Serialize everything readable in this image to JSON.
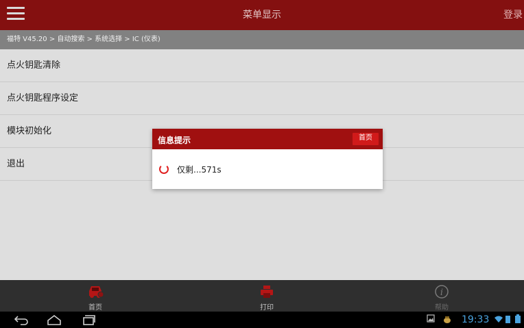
{
  "topbar": {
    "title": "菜单显示",
    "login_label": "登录"
  },
  "breadcrumb": "福特 V45.20 > 自动搜索 > 系统选择 > IC (仪表)",
  "menu": {
    "items": [
      {
        "label": "点火钥匙清除"
      },
      {
        "label": "点火钥匙程序设定"
      },
      {
        "label": "模块初始化"
      },
      {
        "label": "退出"
      }
    ]
  },
  "dialog": {
    "title": "信息提示",
    "home_label": "首页",
    "message": "仅剩...571s"
  },
  "bottom_tabs": [
    {
      "label": "首页",
      "icon": "car-icon"
    },
    {
      "label": "打印",
      "icon": "printer-icon"
    },
    {
      "label": "帮助",
      "icon": "info-icon"
    }
  ],
  "status": {
    "time": "19:33"
  },
  "colors": {
    "brand_red": "#8d1212",
    "dialog_red": "#a01010",
    "accent": "#d11a1a",
    "clock_blue": "#4aa3df"
  }
}
